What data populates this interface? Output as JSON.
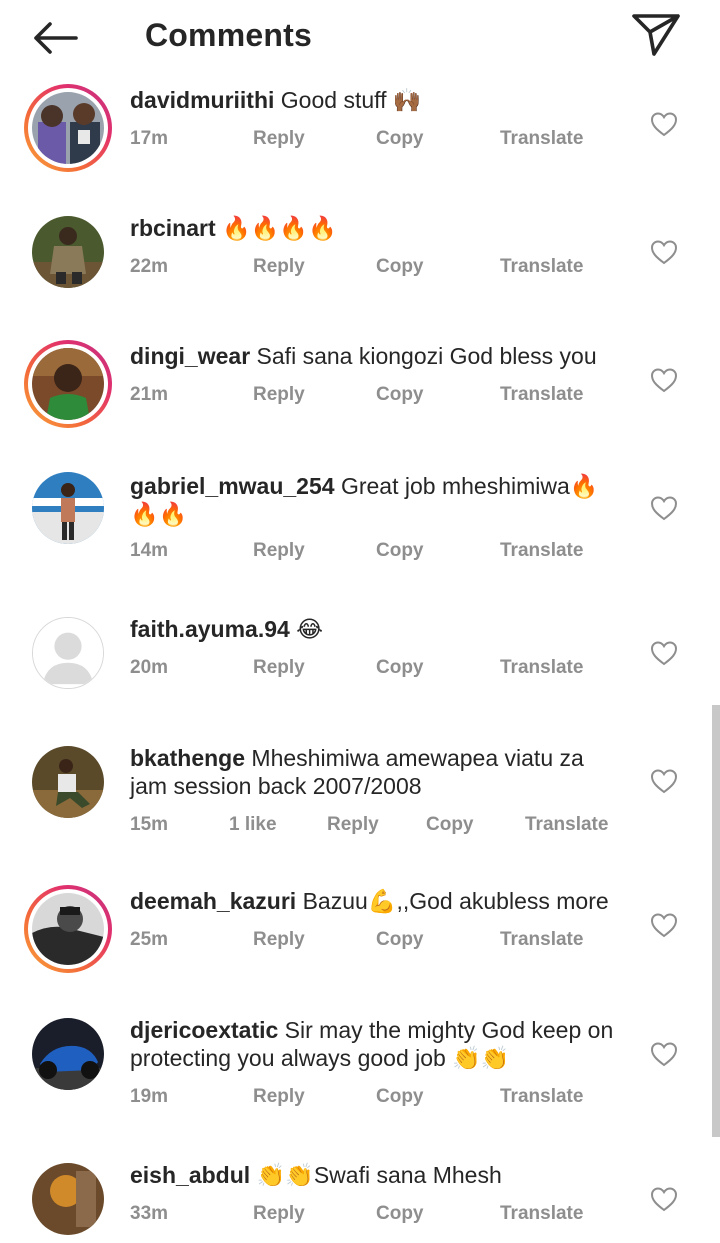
{
  "header": {
    "title": "Comments",
    "back_icon": "arrow-left-icon",
    "send_icon": "paper-plane-icon"
  },
  "actions": {
    "reply": "Reply",
    "copy": "Copy",
    "translate": "Translate"
  },
  "colors": {
    "meta": "#8e8e8e",
    "text": "#262626",
    "story_ring_start": "#f9a43a",
    "story_ring_end": "#c13584"
  },
  "comments": [
    {
      "user": "davidmuriithi",
      "text": " Good stuff 🙌🏾",
      "time": "17m",
      "likes": ""
    },
    {
      "user": "rbcinart",
      "text": " 🔥🔥🔥🔥",
      "time": "22m",
      "likes": ""
    },
    {
      "user": "dingi_wear",
      "text": " Safi sana kiongozi God bless you",
      "time": "21m",
      "likes": ""
    },
    {
      "user": "gabriel_mwau_254",
      "text": " Great job mheshimiwa🔥🔥🔥",
      "time": "14m",
      "likes": ""
    },
    {
      "user": "faith.ayuma.94",
      "text": " 😂",
      "time": "20m",
      "likes": ""
    },
    {
      "user": "bkathenge",
      "text": " Mheshimiwa amewapea viatu za jam session back 2007/2008",
      "time": "15m",
      "likes": "1 like"
    },
    {
      "user": "deemah_kazuri",
      "text": " Bazuu💪,,God akubless more",
      "time": "25m",
      "likes": ""
    },
    {
      "user": "djericoextatic",
      "text": " Sir may the mighty God keep on protecting you always good job 👏👏",
      "time": "19m",
      "likes": ""
    },
    {
      "user": "eish_abdul",
      "text": " 👏👏Swafi sana Mhesh",
      "time": "33m",
      "likes": ""
    }
  ]
}
